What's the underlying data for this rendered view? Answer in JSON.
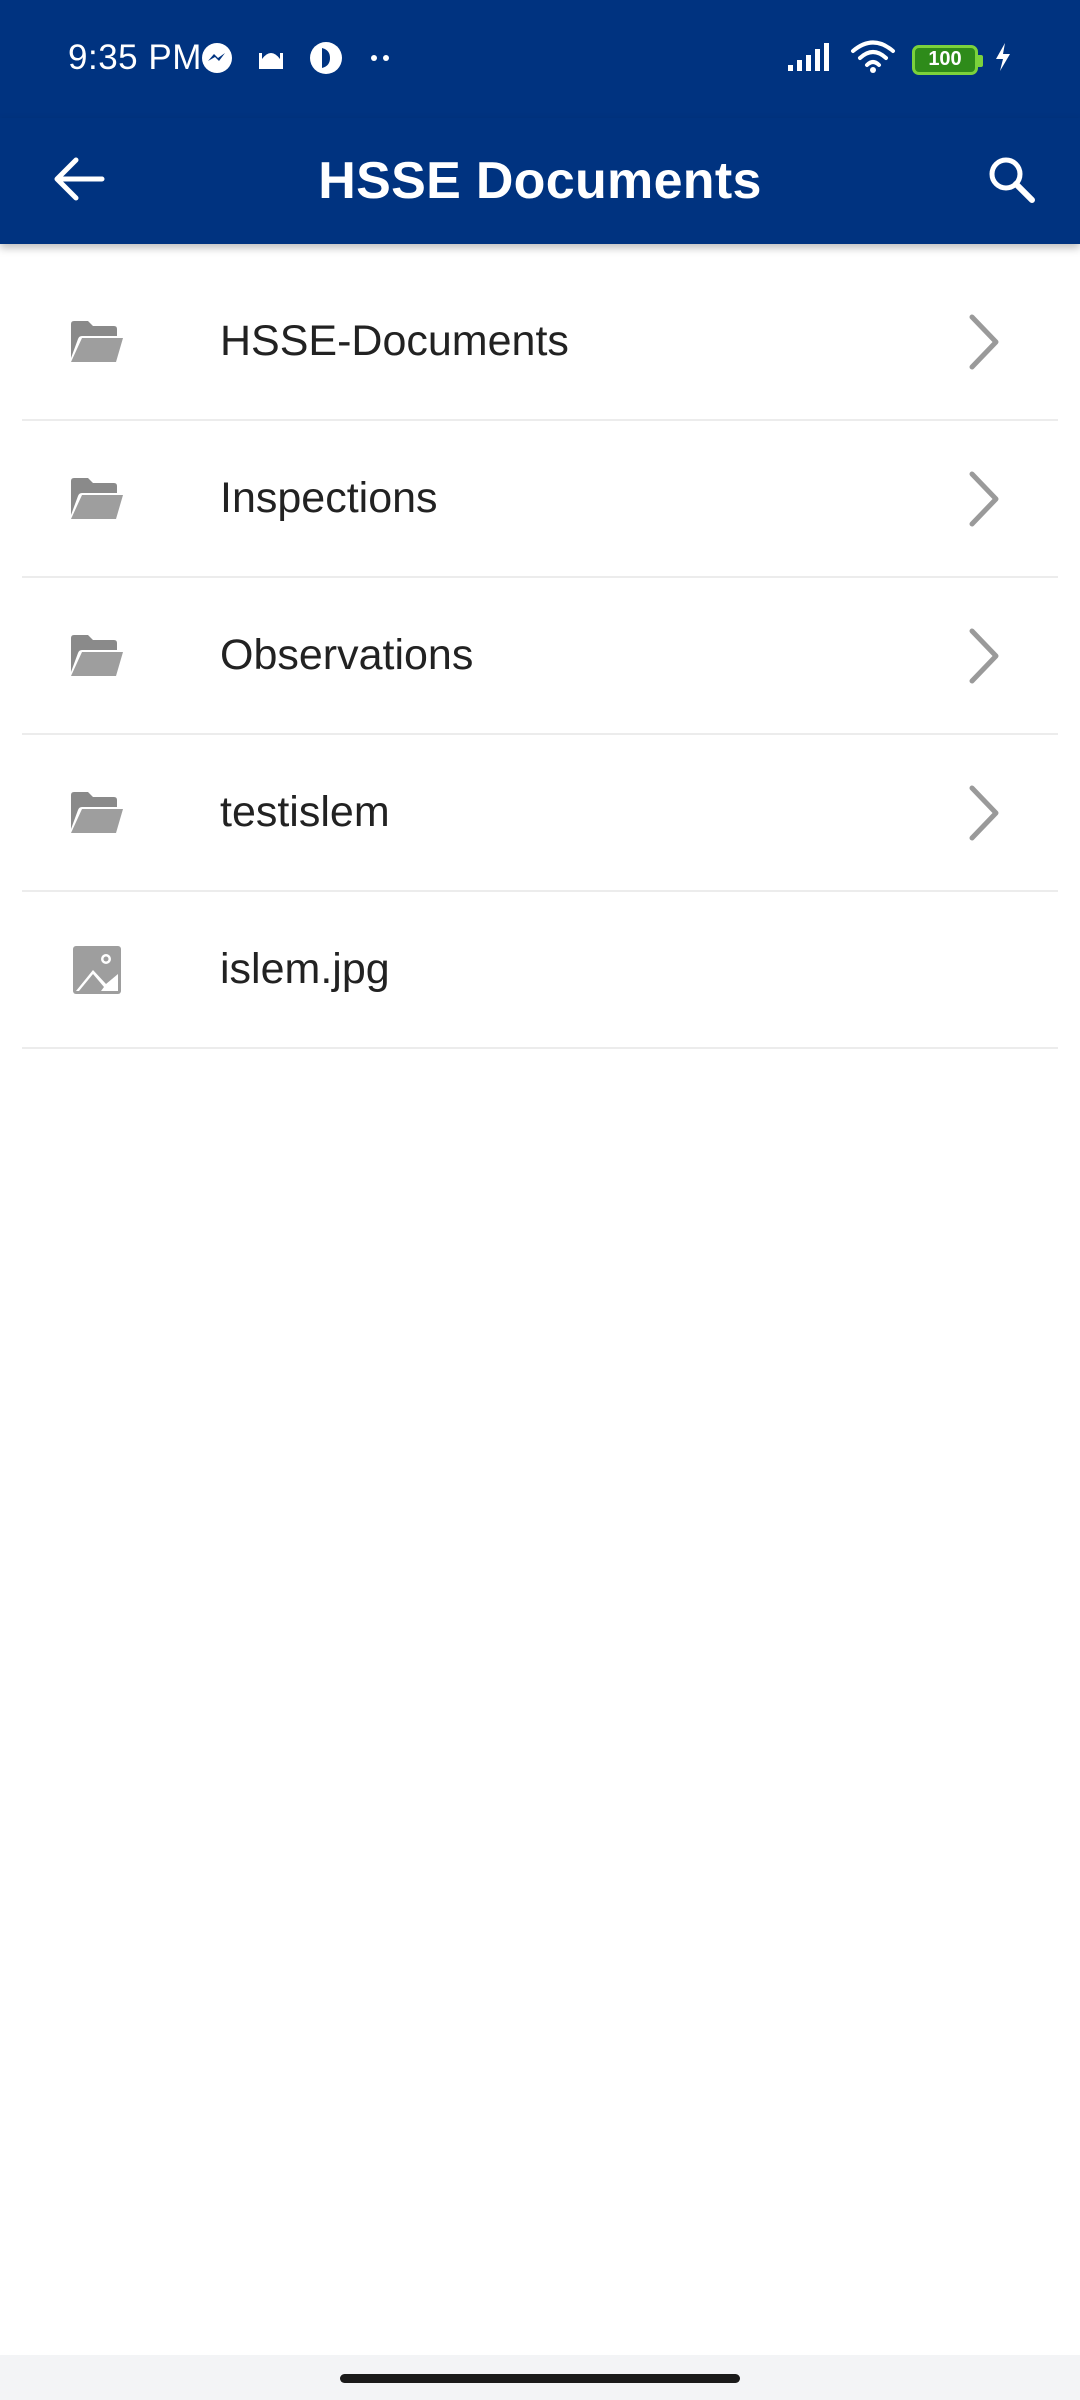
{
  "status_bar": {
    "time": "9:35 PM",
    "battery_level": "100",
    "notification_icons": [
      "messenger-icon",
      "mosque-icon",
      "app-circle-icon",
      "more-dots-icon"
    ],
    "system_icons": [
      "signal-icon",
      "wifi-icon",
      "battery-icon",
      "charging-icon"
    ]
  },
  "app_bar": {
    "title": "HSSE Documents",
    "back_icon": "arrow-left-icon",
    "search_icon": "search-icon",
    "background": "#003380"
  },
  "items": [
    {
      "label": "HSSE-Documents",
      "type": "folder",
      "icon": "folder-icon",
      "has_chevron": true
    },
    {
      "label": "Inspections",
      "type": "folder",
      "icon": "folder-icon",
      "has_chevron": true
    },
    {
      "label": "Observations",
      "type": "folder",
      "icon": "folder-icon",
      "has_chevron": true
    },
    {
      "label": "testislem",
      "type": "folder",
      "icon": "folder-icon",
      "has_chevron": true
    },
    {
      "label": "islem.jpg",
      "type": "image",
      "icon": "image-file-icon",
      "has_chevron": false
    }
  ]
}
